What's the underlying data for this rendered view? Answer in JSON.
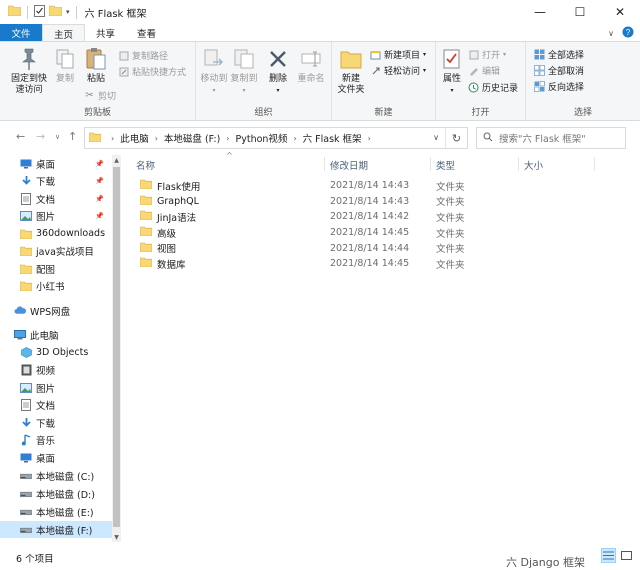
{
  "window": {
    "title": "六 Flask 框架",
    "minimize_glyph": "—",
    "maximize_glyph": "☐",
    "close_glyph": "✕"
  },
  "tabs": {
    "file": "文件",
    "home": "主页",
    "share": "共享",
    "view": "查看"
  },
  "ribbon": {
    "clipboard": {
      "label": "剪贴板",
      "pin": "固定到快\n速访问",
      "copy": "复制",
      "paste": "粘贴",
      "copy_path": "复制路径",
      "paste_shortcut": "粘贴快捷方式",
      "cut": "剪切"
    },
    "organize": {
      "label": "组织",
      "move_to": "移动到",
      "copy_to": "复制到",
      "delete": "删除",
      "rename": "重命名"
    },
    "new": {
      "label": "新建",
      "new_folder": "新建\n文件夹",
      "new_item": "新建项目",
      "easy_access": "轻松访问"
    },
    "open": {
      "label": "打开",
      "properties": "属性",
      "open": "打开",
      "edit": "编辑",
      "history": "历史记录"
    },
    "select": {
      "label": "选择",
      "select_all": "全部选择",
      "select_none": "全部取消",
      "invert": "反向选择"
    }
  },
  "address": {
    "crumbs": [
      "此电脑",
      "本地磁盘 (F:)",
      "Python视频",
      "六 Flask 框架"
    ],
    "search_placeholder": "搜索\"六 Flask 框架\""
  },
  "nav": {
    "items": [
      {
        "label": "桌面",
        "icon": "desktop-icon",
        "pinned": true
      },
      {
        "label": "下载",
        "icon": "download-icon",
        "pinned": true
      },
      {
        "label": "文档",
        "icon": "document-icon",
        "pinned": true
      },
      {
        "label": "图片",
        "icon": "picture-icon",
        "pinned": true
      },
      {
        "label": "360downloads",
        "icon": "folder-icon",
        "pinned": false
      },
      {
        "label": "java实战项目",
        "icon": "folder-icon",
        "pinned": false
      },
      {
        "label": "配图",
        "icon": "folder-icon",
        "pinned": false
      },
      {
        "label": "小红书",
        "icon": "folder-icon",
        "pinned": false
      },
      {
        "label": "WPS网盘",
        "icon": "cloud-icon",
        "pinned": false
      },
      {
        "label": "此电脑",
        "icon": "pc-icon",
        "pinned": false
      },
      {
        "label": "3D Objects",
        "icon": "3d-objects-icon",
        "pinned": false
      },
      {
        "label": "视频",
        "icon": "video-icon",
        "pinned": false
      },
      {
        "label": "图片",
        "icon": "picture-icon",
        "pinned": false
      },
      {
        "label": "文档",
        "icon": "document-icon",
        "pinned": false
      },
      {
        "label": "下载",
        "icon": "download-icon",
        "pinned": false
      },
      {
        "label": "音乐",
        "icon": "music-icon",
        "pinned": false
      },
      {
        "label": "桌面",
        "icon": "desktop-icon",
        "pinned": false
      },
      {
        "label": "本地磁盘 (C:)",
        "icon": "drive-icon",
        "pinned": false
      },
      {
        "label": "本地磁盘 (D:)",
        "icon": "drive-icon",
        "pinned": false
      },
      {
        "label": "本地磁盘 (E:)",
        "icon": "drive-icon",
        "pinned": false
      },
      {
        "label": "本地磁盘 (F:)",
        "icon": "drive-icon",
        "pinned": false,
        "selected": true
      }
    ]
  },
  "columns": {
    "name": "名称",
    "modified": "修改日期",
    "type": "类型",
    "size": "大小"
  },
  "files": [
    {
      "name": "Flask使用",
      "modified": "2021/8/14 14:43",
      "type": "文件夹"
    },
    {
      "name": "GraphQL",
      "modified": "2021/8/14 14:43",
      "type": "文件夹"
    },
    {
      "name": "JinJa语法",
      "modified": "2021/8/14 14:42",
      "type": "文件夹"
    },
    {
      "name": "高级",
      "modified": "2021/8/14 14:45",
      "type": "文件夹"
    },
    {
      "name": "视图",
      "modified": "2021/8/14 14:44",
      "type": "文件夹"
    },
    {
      "name": "数据库",
      "modified": "2021/8/14 14:45",
      "type": "文件夹"
    }
  ],
  "status": {
    "count": "6 个项目"
  },
  "background_text": "六 Django 框架",
  "colors": {
    "accent": "#1979ca",
    "folder": "#f8d775",
    "selected": "#cce8ff"
  }
}
